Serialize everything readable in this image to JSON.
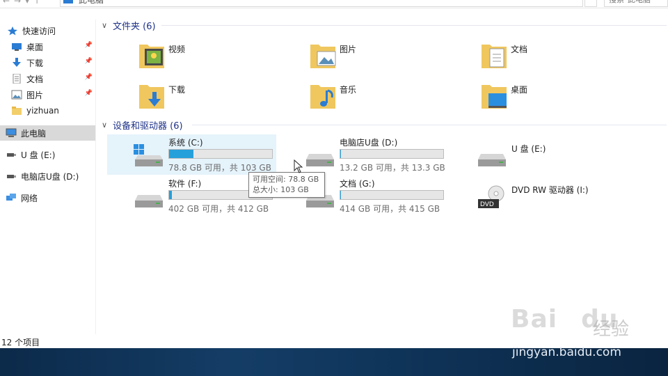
{
  "address": {
    "path_text": "此电脑",
    "search_placeholder": "搜索\"此电脑\""
  },
  "sidebar": {
    "items": [
      {
        "label": "快速访问",
        "icon": "star-icon",
        "pinned": false
      },
      {
        "label": "桌面",
        "icon": "desktop-icon",
        "pinned": true
      },
      {
        "label": "下载",
        "icon": "download-icon",
        "pinned": true
      },
      {
        "label": "文档",
        "icon": "document-icon",
        "pinned": true
      },
      {
        "label": "图片",
        "icon": "picture-icon",
        "pinned": true
      },
      {
        "label": "yizhuan",
        "icon": "folder-icon",
        "pinned": false
      },
      {
        "label": "此电脑",
        "icon": "computer-icon",
        "pinned": false,
        "selected": true
      },
      {
        "label": "U 盘 (E:)",
        "icon": "usb-drive-icon",
        "pinned": false
      },
      {
        "label": "电脑店U盘 (D:)",
        "icon": "usb-drive-icon",
        "pinned": false
      },
      {
        "label": "网络",
        "icon": "network-icon",
        "pinned": false
      }
    ]
  },
  "folders_group": {
    "title": "文件夹 (6)",
    "items": [
      {
        "label": "视频",
        "icon": "videos-folder-icon"
      },
      {
        "label": "图片",
        "icon": "pictures-folder-icon"
      },
      {
        "label": "文档",
        "icon": "documents-folder-icon"
      },
      {
        "label": "下载",
        "icon": "downloads-folder-icon"
      },
      {
        "label": "音乐",
        "icon": "music-folder-icon"
      },
      {
        "label": "桌面",
        "icon": "desktop-folder-icon"
      }
    ]
  },
  "drives_group": {
    "title": "设备和驱动器 (6)",
    "items": [
      {
        "name": "系统 (C:)",
        "info": "78.8 GB 可用，共 103 GB",
        "used_fraction": 0.235,
        "icon": "windows-drive-icon"
      },
      {
        "name": "电脑店U盘 (D:)",
        "info": "13.2 GB 可用，共 13.3 GB",
        "used_fraction": 0.01,
        "icon": "hard-drive-icon"
      },
      {
        "name": "U 盘 (E:)",
        "info": "",
        "used_fraction": null,
        "icon": "hard-drive-icon"
      },
      {
        "name": "软件 (F:)",
        "info": "402 GB 可用，共 412 GB",
        "used_fraction": 0.024,
        "icon": "hard-drive-icon"
      },
      {
        "name": "文档 (G:)",
        "info": "414 GB 可用，共 415 GB",
        "used_fraction": 0.002,
        "icon": "hard-drive-icon"
      },
      {
        "name": "DVD RW 驱动器 (I:)",
        "info": "",
        "used_fraction": null,
        "icon": "dvd-drive-icon"
      }
    ]
  },
  "tooltip": {
    "line1": "可用空间: 78.8 GB",
    "line2": "总大小: 103 GB"
  },
  "status": {
    "count": "12 个项目"
  },
  "watermark": {
    "brand": "Bai",
    "brand2": "du",
    "jingyan": "经验",
    "url": "jingyan.baidu.com"
  },
  "colors": {
    "selection": "#d9d9d9",
    "hover": "#e5f3fb",
    "bar_fill": "#26a0da",
    "group_header": "#1e3287"
  }
}
